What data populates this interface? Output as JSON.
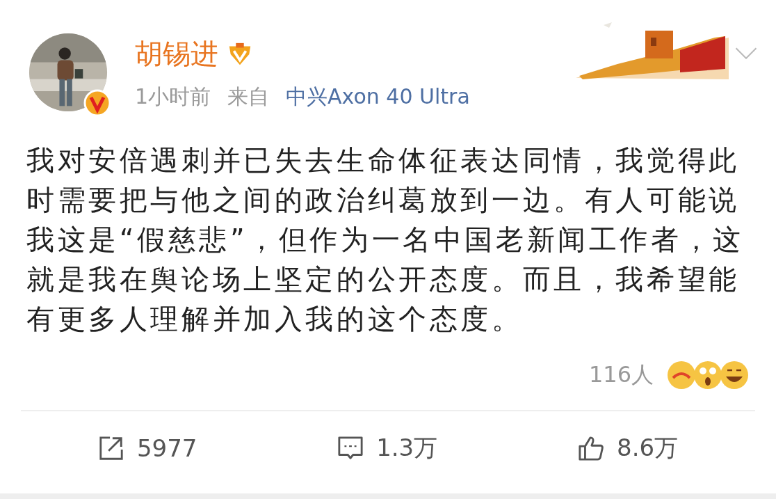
{
  "post": {
    "author": "胡锡进",
    "time": "1小时前",
    "source_label": "来自",
    "source": "中兴Axon 40 Ultra",
    "text": "我对安倍遇刺并已失去生命体征表达同情，我觉得此时需要把与他之间的政治纠葛放到一边。有人可能说我这是“假慈悲”，但作为一名中国老新闻工作者，这就是我在舆论场上坚定的公开态度。而且，我希望能有更多人理解并加入我的这个态度。",
    "reactions_count": "116人"
  },
  "actions": [
    {
      "kind": "repost",
      "count": "5977"
    },
    {
      "kind": "comment",
      "count": "1.3万"
    },
    {
      "kind": "like",
      "count": "8.6万"
    }
  ]
}
